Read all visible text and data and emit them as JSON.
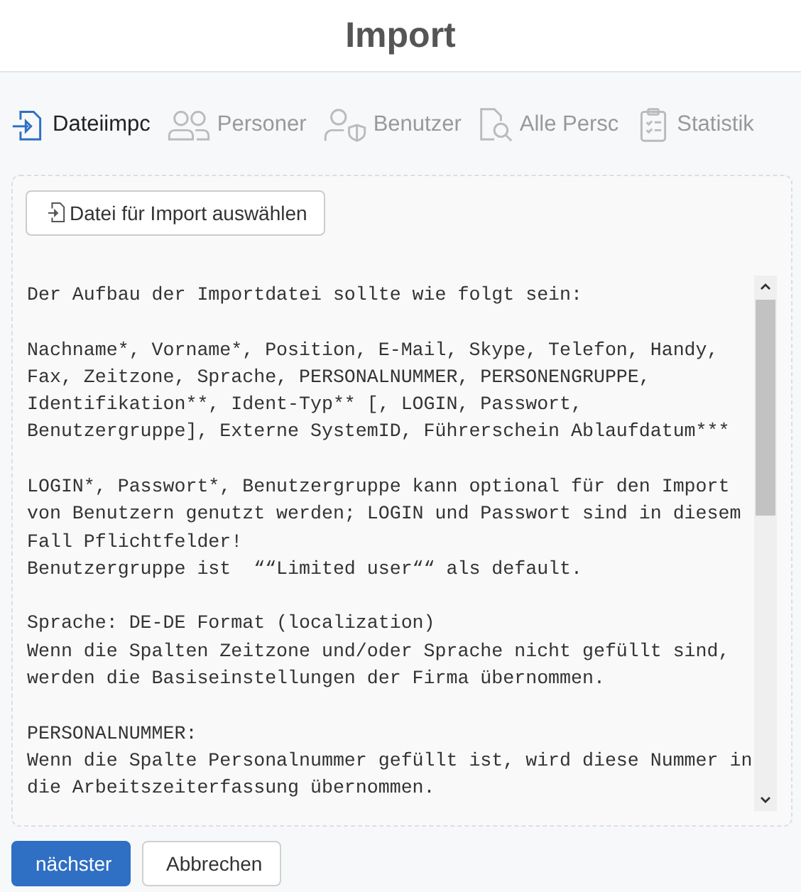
{
  "title": "Import",
  "tabs": [
    {
      "label": "Dateiimpc",
      "selected": true
    },
    {
      "label": "Personer",
      "selected": false
    },
    {
      "label": "Benutzer",
      "selected": false
    },
    {
      "label": "Alle Persc",
      "selected": false
    },
    {
      "label": "Statistik",
      "selected": false
    }
  ],
  "file_button": "Datei für Import auswählen",
  "description": [
    [
      "Der Aufbau der Importdatei sollte wie folgt sein:"
    ],
    [
      "Nachname*, Vorname*, Position, E-Mail, Skype, Telefon, Handy,",
      "Fax, Zeitzone, Sprache, PERSONALNUMMER, PERSONENGRUPPE,",
      "Identifikation**, Ident-Typ** [, LOGIN, Passwort,",
      "Benutzergruppe], Externe SystemID, Führerschein Ablaufdatum***"
    ],
    [
      "LOGIN*, Passwort*, Benutzergruppe kann optional für den Import",
      "von Benutzern genutzt werden; LOGIN und Passwort sind in diesem",
      "Fall Pflichtfelder!",
      "Benutzergruppe ist  ““Limited user““ als default."
    ],
    [
      "Sprache: DE-DE Format (localization)",
      "Wenn die Spalten Zeitzone und/oder Sprache nicht gefüllt sind,",
      "werden die Basiseinstellungen der Firma übernommen."
    ],
    [
      "PERSONALNUMMER:",
      "Wenn die Spalte Personalnummer gefüllt ist, wird diese Nummer in",
      "die Arbeitszeiterfassung übernommen."
    ]
  ],
  "buttons": [
    {
      "label": "nächster",
      "kind": "primary"
    },
    {
      "label": "Abbrechen",
      "kind": "secondary"
    }
  ]
}
